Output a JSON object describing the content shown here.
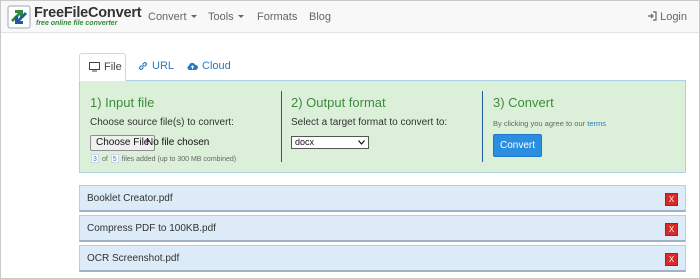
{
  "brand": {
    "title": "FreeFileConvert",
    "tagline": "free online file converter",
    "colors": {
      "green": "#2e8b3a",
      "blue": "#1f5aa0"
    }
  },
  "nav": {
    "items": [
      {
        "label": "Convert",
        "dropdown": true
      },
      {
        "label": "Tools",
        "dropdown": true
      },
      {
        "label": "Formats",
        "dropdown": false
      },
      {
        "label": "Blog",
        "dropdown": false
      }
    ],
    "login": {
      "label": "Login",
      "icon": "login-icon"
    }
  },
  "tabs": [
    {
      "label": "File",
      "icon": "monitor-icon",
      "active": true
    },
    {
      "label": "URL",
      "icon": "link-icon",
      "active": false
    },
    {
      "label": "Cloud",
      "icon": "cloud-upload-icon",
      "active": false
    }
  ],
  "steps": {
    "input": {
      "title": "1) Input file",
      "instruction": "Choose source file(s) to convert:",
      "choose_label": "Choose File",
      "no_file_text": "No file chosen",
      "files_count": "3",
      "of_text": "of",
      "files_max": "5",
      "files_suffix": "files added (up to 300 MB combined)"
    },
    "output": {
      "title": "2) Output format",
      "instruction": "Select a target format to convert to:",
      "selected_format": "docx"
    },
    "convert": {
      "title": "3) Convert",
      "terms_prefix": "By clicking you agree to our",
      "terms_link": "terms",
      "button_label": "Convert"
    }
  },
  "files": [
    {
      "name": "Booklet Creator.pdf",
      "remove_label": "X"
    },
    {
      "name": "Compress PDF to 100KB.pdf",
      "remove_label": "X"
    },
    {
      "name": "OCR Screenshot.pdf",
      "remove_label": "X"
    }
  ]
}
